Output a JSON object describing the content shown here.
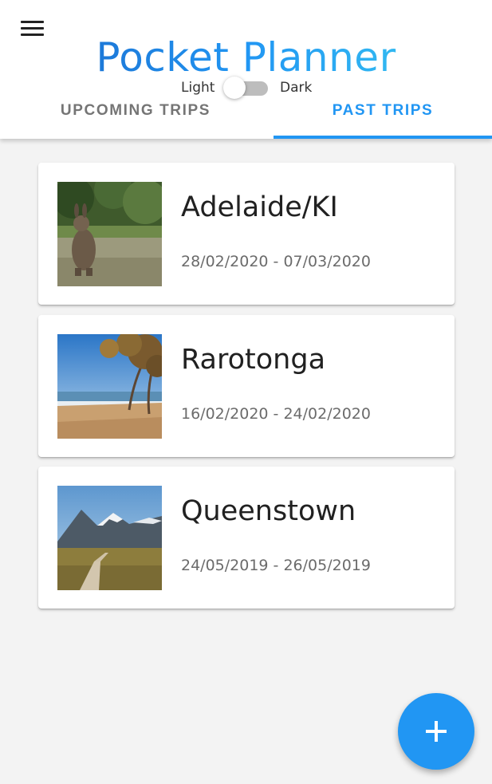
{
  "app": {
    "title": "Pocket Planner"
  },
  "header": {
    "menu_icon": "menu-icon",
    "theme": {
      "light_label": "Light",
      "dark_label": "Dark",
      "dark_enabled": false
    }
  },
  "tabs": [
    {
      "label": "UPCOMING TRIPS",
      "active": false
    },
    {
      "label": "PAST TRIPS",
      "active": true
    }
  ],
  "trips": [
    {
      "name": "Adelaide/KI",
      "dates": "28/02/2020 - 07/03/2020",
      "image": "kangaroo-photo"
    },
    {
      "name": "Rarotonga",
      "dates": "16/02/2020 - 24/02/2020",
      "image": "beach-palm-photo"
    },
    {
      "name": "Queenstown",
      "dates": "24/05/2019 - 26/05/2019",
      "image": "mountain-boardwalk-photo"
    }
  ],
  "fab": {
    "icon": "plus-icon"
  },
  "colors": {
    "accent": "#2196f3",
    "title_start": "#1a66c7",
    "title_end": "#3ccdf0"
  }
}
